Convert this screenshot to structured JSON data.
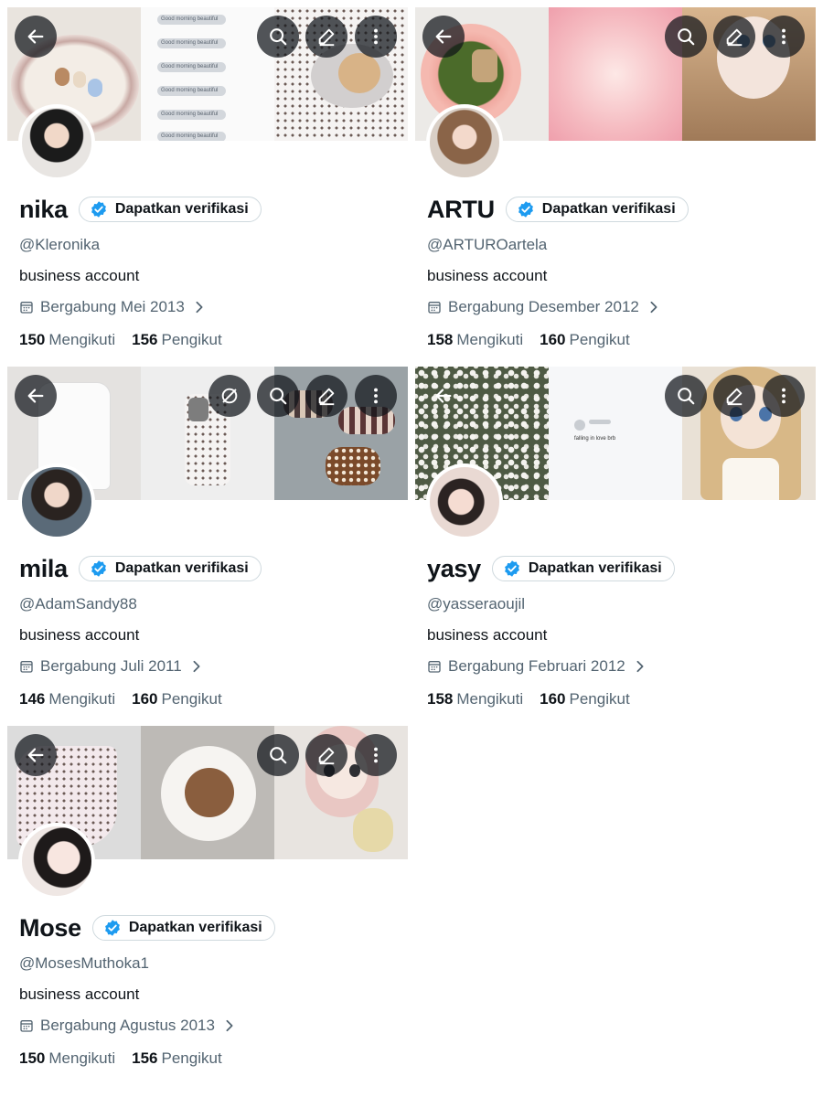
{
  "verify_label": "Dapatkan verifikasi",
  "colors": {
    "verify_badge": "#1d9bf0",
    "text_primary": "#0f1419",
    "text_secondary": "#536471",
    "button_overlay": "#0f1419"
  },
  "icons": {
    "back": "arrow-left-icon",
    "search": "search-icon",
    "edit": "pencil-icon",
    "more": "more-vertical-icon",
    "extra": "no-notification-icon",
    "badge": "verified-badge-icon",
    "calendar": "calendar-icon",
    "chevron": "chevron-right-icon"
  },
  "banner_chat": [
    "Good morning beautiful",
    "Good morning beautiful",
    "Good morning beautiful",
    "Good morning beautiful",
    "Good morning beautiful",
    "Good morning beautiful"
  ],
  "banner_tweet": "falling in love brb",
  "profiles": [
    {
      "name": "nika",
      "handle": "@Kleronika",
      "bio": "business account",
      "joined": "Bergabung Mei 2013",
      "following_count": "150",
      "following_label": "Mengikuti",
      "followers_count": "156",
      "followers_label": "Pengikut"
    },
    {
      "name": "ARTU",
      "handle": "@ARTUROartela",
      "bio": "business account",
      "joined": "Bergabung Desember 2012",
      "following_count": "158",
      "following_label": "Mengikuti",
      "followers_count": "160",
      "followers_label": "Pengikut"
    },
    {
      "name": "mila",
      "handle": "@AdamSandy88",
      "bio": "business account",
      "joined": "Bergabung Juli 2011",
      "following_count": "146",
      "following_label": "Mengikuti",
      "followers_count": "160",
      "followers_label": "Pengikut"
    },
    {
      "name": "yasy",
      "handle": "@yasseraoujil",
      "bio": "business account",
      "joined": "Bergabung Februari 2012",
      "following_count": "158",
      "following_label": "Mengikuti",
      "followers_count": "160",
      "followers_label": "Pengikut"
    },
    {
      "name": "Mose",
      "handle": "@MosesMuthoka1",
      "bio": "business account",
      "joined": "Bergabung Agustus 2013",
      "following_count": "150",
      "following_label": "Mengikuti",
      "followers_count": "156",
      "followers_label": "Pengikut"
    }
  ]
}
